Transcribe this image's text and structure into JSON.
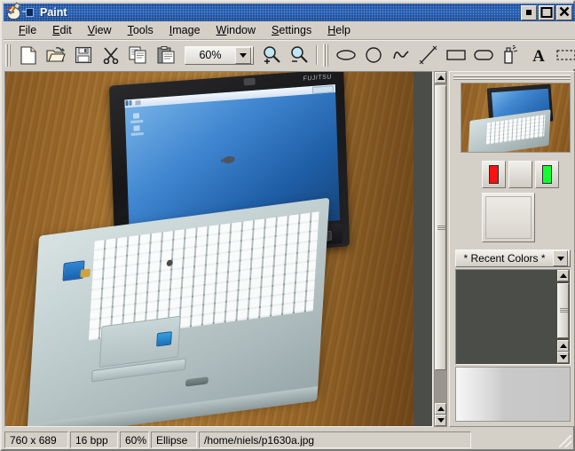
{
  "window": {
    "title": "Paint",
    "icon": "paint-palette-icon",
    "pin_icon": "pin-icon",
    "buttons": [
      {
        "name": "minimize-button",
        "glyph": "minimize"
      },
      {
        "name": "maximize-button",
        "glyph": "maximize"
      },
      {
        "name": "close-button",
        "glyph": "✖"
      }
    ]
  },
  "menubar": {
    "items": [
      {
        "label": "File",
        "mnemonic": "F"
      },
      {
        "label": "Edit",
        "mnemonic": "E"
      },
      {
        "label": "View",
        "mnemonic": "V"
      },
      {
        "label": "Tools",
        "mnemonic": "T"
      },
      {
        "label": "Image",
        "mnemonic": "I"
      },
      {
        "label": "Window",
        "mnemonic": "W"
      },
      {
        "label": "Settings",
        "mnemonic": "S"
      },
      {
        "label": "Help",
        "mnemonic": "H"
      }
    ]
  },
  "toolbar": {
    "file_tools": [
      {
        "name": "new-button",
        "icon": "new-document-icon"
      },
      {
        "name": "open-button",
        "icon": "open-folder-icon"
      },
      {
        "name": "save-button",
        "icon": "floppy-disk-icon"
      }
    ],
    "edit_tools": [
      {
        "name": "cut-button",
        "icon": "scissors-icon"
      },
      {
        "name": "copy-button",
        "icon": "copy-icon"
      },
      {
        "name": "paste-button",
        "icon": "clipboard-paste-icon"
      }
    ],
    "zoom_combo": {
      "value": "60%",
      "icon": "chevron-down-icon"
    },
    "zoom_in": {
      "name": "zoom-in-button",
      "icon": "magnifier-plus-icon",
      "sign": "+"
    },
    "zoom_out": {
      "name": "zoom-out-button",
      "icon": "magnifier-minus-icon",
      "sign": "−"
    },
    "draw_tools": [
      {
        "name": "ellipse-outline-tool",
        "icon": "ellipse-icon",
        "active": false
      },
      {
        "name": "circle-tool",
        "icon": "circle-icon",
        "active": false
      },
      {
        "name": "curve-tool",
        "icon": "curve-icon",
        "active": false
      },
      {
        "name": "line-tool",
        "icon": "line-icon",
        "active": false
      },
      {
        "name": "rectangle-tool",
        "icon": "rectangle-icon",
        "active": false
      },
      {
        "name": "rounded-rect-tool",
        "icon": "rounded-rectangle-icon",
        "active": false
      },
      {
        "name": "spray-tool",
        "icon": "spray-can-icon",
        "active": false
      },
      {
        "name": "text-tool",
        "icon": "text-a-icon",
        "active": false
      },
      {
        "name": "select-tool",
        "icon": "dashed-selection-icon",
        "active": false
      },
      {
        "name": "split-view-tool",
        "icon": "split-box-icon",
        "active": true
      }
    ]
  },
  "canvas": {
    "image_description": "Fujitsu convertible tablet laptop on a wooden desk with blue Windows desktop on screen",
    "screen_brand": "FUJITSU"
  },
  "right_panel": {
    "preview_name": "image-thumbnail-preview",
    "color_buttons": [
      {
        "name": "foreground-color-button",
        "color": "#ff1010"
      },
      {
        "name": "background-color-button",
        "color": ""
      },
      {
        "name": "alt-color-button",
        "color": "#10ff30"
      }
    ],
    "palette_combo": {
      "label": "* Recent Colors *",
      "icon": "chevron-down-icon"
    },
    "swatch_area_name": "color-swatch-list",
    "gradient_area_name": "color-gradient-strip"
  },
  "statusbar": {
    "fields": [
      {
        "name": "image-size-field",
        "value": "760 x 689"
      },
      {
        "name": "color-depth-field",
        "value": "16 bpp"
      },
      {
        "name": "zoom-level-field",
        "value": "60%"
      },
      {
        "name": "active-tool-field",
        "value": "Ellipse"
      },
      {
        "name": "file-path-field",
        "value": "/home/niels/p1630a.jpg"
      }
    ]
  },
  "colors": {
    "titlebar": "#1d4f9e",
    "face": "#d4d0c8",
    "canvas_bg": "#4a4d48",
    "swatch_bg": "#4a4d48"
  }
}
